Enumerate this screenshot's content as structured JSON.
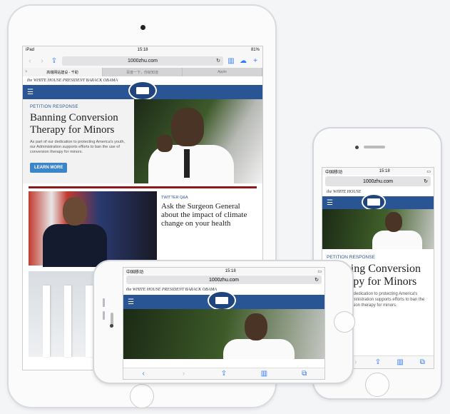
{
  "ipad": {
    "status": {
      "device": "iPad",
      "time": "15:18",
      "battery": "81%"
    },
    "url": "1000zhu.com",
    "tabs": [
      {
        "label": "高端网站建设 - 千助",
        "active": true
      },
      {
        "label": "百度一下，你就知道",
        "active": false
      },
      {
        "label": "Apple",
        "active": false
      }
    ],
    "header_strip": "the WHITE HOUSE   PRESIDENT BARACK OBAMA",
    "hero": {
      "kicker": "PETITION RESPONSE",
      "title": "Banning Conversion Therapy for Minors",
      "body": "As part of our dedication to protecting America's youth, our Administration supports efforts to ban the use of conversion therapy for minors.",
      "button": "LEARN MORE"
    },
    "card2": {
      "kicker": "TWITTER Q&A",
      "title": "Ask the Surgeon General about the impact of climate change on your health"
    }
  },
  "iphone_portrait": {
    "status": {
      "carrier": "中国移动",
      "time": "15:18"
    },
    "url": "1000zhu.com",
    "header_strip": "the WHITE HOUSE",
    "kicker": "PETITION RESPONSE",
    "title": "Banning Conversion Therapy for Minors",
    "body": "As part of our dedication to protecting America's youth, our Administration supports efforts to ban the use of conversion therapy for minors."
  },
  "iphone_landscape": {
    "status": {
      "carrier": "中国移动",
      "time": "15:18"
    },
    "url": "1000zhu.com",
    "header_strip": "the WHITE HOUSE   PRESIDENT BARACK OBAMA"
  },
  "icons": [
    "back-icon",
    "forward-icon",
    "share-icon",
    "bookmarks-icon",
    "cloud-icon",
    "plus-icon",
    "reload-icon",
    "menu-icon",
    "tabs-icon"
  ],
  "colors": {
    "accent": "#2f7bf5",
    "navbar": "#2a5595",
    "button": "#3d85c9",
    "rule": "#8b1a1a"
  }
}
